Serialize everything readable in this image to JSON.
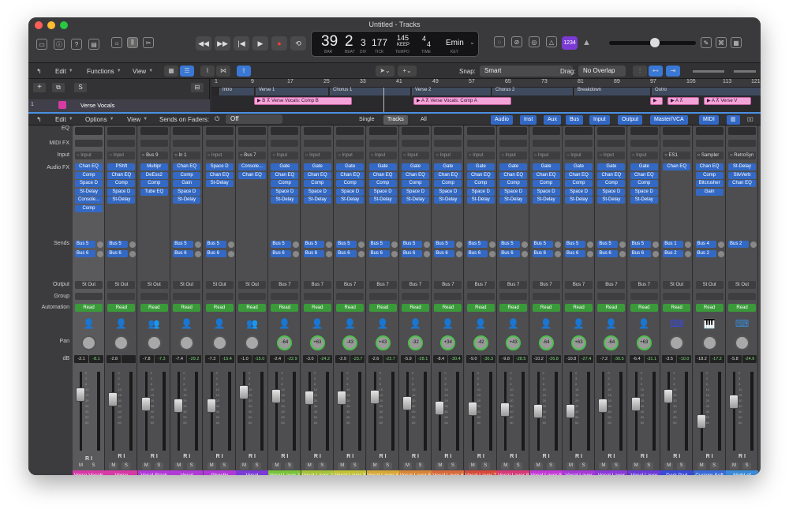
{
  "window": {
    "title": "Untitled - Tracks"
  },
  "lcd": {
    "bar": "39",
    "beat": "2",
    "div": "3",
    "tick": "177",
    "tempo": "145",
    "tempo_mode": "KEEP",
    "sig_top": "4",
    "sig_bottom": "4",
    "key": "Emin",
    "labels": {
      "bar": "BAR",
      "beat": "BEAT",
      "div": "DIV",
      "tick": "TICK",
      "tempo": "TEMPO",
      "time": "TIME",
      "key": "KEY"
    }
  },
  "count_in_badge": "1234",
  "tracks_toolbar": {
    "edit": "Edit",
    "functions": "Functions",
    "view": "View",
    "snap_label": "Snap:",
    "snap_value": "Smart",
    "drag_label": "Drag:",
    "drag_value": "No Overlap"
  },
  "arrange": {
    "track_number": "1",
    "track_name": "Verse Vocals",
    "ruler_ticks": [
      "1",
      "9",
      "17",
      "25",
      "33",
      "41",
      "49",
      "57",
      "65",
      "73",
      "81",
      "89",
      "97",
      "105",
      "113",
      "121"
    ],
    "markers": [
      "Intro",
      "Verse 1",
      "Chorus 1",
      "Verse 2",
      "Chorus 2",
      "Breakdown",
      "Outro"
    ],
    "regions": [
      "Verse Vocals: Comp B",
      "Verse Vocals: Comp A",
      "Verse V"
    ]
  },
  "mixer_toolbar": {
    "edit": "Edit",
    "options": "Options",
    "view": "View",
    "sends_on_faders_label": "Sends on Faders:",
    "sends_on_faders_value": "Off",
    "single": "Single",
    "tracks": "Tracks",
    "all": "All",
    "filters": [
      "Audio",
      "Inst",
      "Aux",
      "Bus",
      "Input",
      "Output",
      "Master/VCA",
      "MIDI"
    ]
  },
  "row_labels": {
    "eq": "EQ",
    "midi_fx": "MIDI FX",
    "input": "Input",
    "audio_fx": "Audio FX",
    "sends": "Sends",
    "output": "Output",
    "group": "Group",
    "automation": "Automation",
    "pan": "Pan",
    "db": "dB"
  },
  "fader_scale": [
    "0",
    "3",
    "6",
    "10",
    "15",
    "20",
    "30",
    "40",
    "50",
    "60"
  ],
  "channels": [
    {
      "name": "Verse Vocals",
      "color": "#d63aa5",
      "icon": "person",
      "input": "Input",
      "fx": [
        "Chan EQ",
        "Comp",
        "Space D",
        "St-Delay",
        "Console...",
        "Comp"
      ],
      "sends": [
        "Bus 5",
        "Bus 6"
      ],
      "output": "St Out",
      "auto": "Read",
      "pan": "",
      "db1": "-2.1",
      "db2": "-8.1",
      "fader": 0.74,
      "ri": "R I"
    },
    {
      "name": "Verse Harmony",
      "color": "#d63aa5",
      "icon": "person",
      "input": "Input",
      "fx": [
        "PShft",
        "Chan EQ",
        "Comp",
        "Space D",
        "St-Delay"
      ],
      "sends": [
        "Bus 5",
        "Bus 6"
      ],
      "output": "St Out",
      "auto": "Read",
      "pan": "",
      "db1": "-2.8",
      "db2": "",
      "fader": 0.68,
      "ri": "R I"
    },
    {
      "name": "Vocal Stack",
      "color": "#b03ad6",
      "icon": "group",
      "input": "Bus 9",
      "fx": [
        "Multipr",
        "DeEss2",
        "Comp",
        "Tube EQ"
      ],
      "sends": [],
      "output": "St Out",
      "auto": "Read",
      "pan": "",
      "db1": "-7.8",
      "db2": "-7.3",
      "fader": 0.6,
      "ri": "R I"
    },
    {
      "name": "Vocal Response",
      "color": "#b03ad6",
      "icon": "person",
      "input": "In 1",
      "fx": [
        "Chan EQ",
        "Comp",
        "Gain",
        "Space D",
        "St-Delay"
      ],
      "sends": [
        "Bus 5",
        "Bus 6"
      ],
      "output": "St Out",
      "auto": "Read",
      "pan": "",
      "db1": "-7.4",
      "db2": "-29.2",
      "fader": 0.58,
      "ri": "R I"
    },
    {
      "name": "Ghostly Vocals",
      "color": "#b03ad6",
      "icon": "person",
      "input": "Input",
      "fx": [
        "Space D",
        "Chan EQ",
        "St-Delay"
      ],
      "sends": [
        "Bus 5",
        "Bus 6"
      ],
      "output": "St Out",
      "auto": "Read",
      "pan": "",
      "db1": "-7.3",
      "db2": "-15.4",
      "fader": 0.58,
      "ri": "R I"
    },
    {
      "name": "Vocal Textures",
      "color": "#7b3ad6",
      "icon": "group",
      "input": "Bus 7",
      "fx": [
        "Console...",
        "Chan EQ"
      ],
      "sends": [],
      "output": "St Out",
      "auto": "Read",
      "pan": "",
      "db1": "-1.0",
      "db2": "-15.0",
      "fader": 0.78,
      "ri": "R I"
    },
    {
      "name": "Vocal Layer 1",
      "color": "#7ac23a",
      "icon": "person",
      "input": "Input",
      "fx": [
        "Gate",
        "Chan EQ",
        "Comp",
        "Space D",
        "St-Delay"
      ],
      "sends": [
        "Bus 5",
        "Bus 6"
      ],
      "output": "Bus 7",
      "auto": "Read",
      "pan": "-64",
      "db1": "-2.4",
      "db2": "-22.9",
      "fader": 0.72,
      "ri": "R I"
    },
    {
      "name": "Vocal Layer 2",
      "color": "#a6c23a",
      "icon": "person",
      "input": "Input",
      "fx": [
        "Gate",
        "Chan EQ",
        "Comp",
        "Space D",
        "St-Delay"
      ],
      "sends": [
        "Bus 5",
        "Bus 6"
      ],
      "output": "Bus 7",
      "auto": "Read",
      "pan": "+63",
      "db1": "-3.0",
      "db2": "-24.2",
      "fader": 0.7,
      "ri": "R I"
    },
    {
      "name": "Vocal Layer 3",
      "color": "#c2c23a",
      "icon": "person",
      "input": "Input",
      "fx": [
        "Gate",
        "Chan EQ",
        "Comp",
        "Space D",
        "St-Delay"
      ],
      "sends": [
        "Bus 5",
        "Bus 6"
      ],
      "output": "Bus 7",
      "auto": "Read",
      "pan": "-43",
      "db1": "-2.9",
      "db2": "-23.7",
      "fader": 0.7,
      "ri": "R I"
    },
    {
      "name": "Vocal Layer 4",
      "color": "#d6a83a",
      "icon": "person",
      "input": "Input",
      "fx": [
        "Gate",
        "Chan EQ",
        "Comp",
        "Space D",
        "St-Delay"
      ],
      "sends": [
        "Bus 5",
        "Bus 6"
      ],
      "output": "Bus 7",
      "auto": "Read",
      "pan": "+43",
      "db1": "-2.6",
      "db2": "-22.7",
      "fader": 0.71,
      "ri": "R I"
    },
    {
      "name": "Vocal Layer 5",
      "color": "#d6863a",
      "icon": "person",
      "input": "Input",
      "fx": [
        "Gate",
        "Chan EQ",
        "Comp",
        "Space D",
        "St-Delay"
      ],
      "sends": [
        "Bus 5",
        "Bus 6"
      ],
      "output": "Bus 7",
      "auto": "Read",
      "pan": "-32",
      "db1": "-5.9",
      "db2": "-28.1",
      "fader": 0.62,
      "ri": "R I"
    },
    {
      "name": "Vocal Layer 6",
      "color": "#d66a3a",
      "icon": "person",
      "input": "Input",
      "fx": [
        "Gate",
        "Chan EQ",
        "Comp",
        "Space D",
        "St-Delay"
      ],
      "sends": [
        "Bus 5",
        "Bus 6"
      ],
      "output": "Bus 7",
      "auto": "Read",
      "pan": "+34",
      "db1": "-8.4",
      "db2": "-30.4",
      "fader": 0.55,
      "ri": "R I"
    },
    {
      "name": "Vocal Layer 7",
      "color": "#d64a3a",
      "icon": "person",
      "input": "Input",
      "fx": [
        "Gate",
        "Chan EQ",
        "Comp",
        "Space D",
        "St-Delay"
      ],
      "sends": [
        "Bus 5",
        "Bus 6"
      ],
      "output": "Bus 7",
      "auto": "Read",
      "pan": "-42",
      "db1": "-9.0",
      "db2": "-30.3",
      "fader": 0.54,
      "ri": "R I"
    },
    {
      "name": "Vocal Layer 8",
      "color": "#d63a78",
      "icon": "person",
      "input": "Input",
      "fx": [
        "Gate",
        "Chan EQ",
        "Comp",
        "Space D",
        "St-Delay"
      ],
      "sends": [
        "Bus 5",
        "Bus 6"
      ],
      "output": "Bus 7",
      "auto": "Read",
      "pan": "+43",
      "db1": "-9.8",
      "db2": "-28.5",
      "fader": 0.52,
      "ri": "R I"
    },
    {
      "name": "Vocal Layer 9",
      "color": "#c23ad6",
      "icon": "person",
      "input": "Input",
      "fx": [
        "Gate",
        "Chan EQ",
        "Comp",
        "Space D",
        "St-Delay"
      ],
      "sends": [
        "Bus 5",
        "Bus 6"
      ],
      "output": "Bus 7",
      "auto": "Read",
      "pan": "-64",
      "db1": "-10.2",
      "db2": "-26.8",
      "fader": 0.5,
      "ri": "R I"
    },
    {
      "name": "Vocal Layer 10",
      "color": "#a63ad6",
      "icon": "person",
      "input": "Input",
      "fx": [
        "Gate",
        "Chan EQ",
        "Comp",
        "Space D",
        "St-Delay"
      ],
      "sends": [
        "Bus 5",
        "Bus 6"
      ],
      "output": "Bus 7",
      "auto": "Read",
      "pan": "+63",
      "db1": "-10.8",
      "db2": "-27.4",
      "fader": 0.5,
      "ri": "R I"
    },
    {
      "name": "Vocal Layer 11",
      "color": "#8a3ad6",
      "icon": "person",
      "input": "Input",
      "fx": [
        "Gate",
        "Chan EQ",
        "Comp",
        "Space D",
        "St-Delay"
      ],
      "sends": [
        "Bus 5",
        "Bus 6"
      ],
      "output": "Bus 7",
      "auto": "Read",
      "pan": "-64",
      "db1": "-7.2",
      "db2": "-30.5",
      "fader": 0.58,
      "ri": "R I"
    },
    {
      "name": "Vocal Layer 12",
      "color": "#6a3ad6",
      "icon": "person",
      "input": "Input",
      "fx": [
        "Gate",
        "Chan EQ",
        "Comp",
        "Space D",
        "St-Delay"
      ],
      "sends": [
        "Bus 5",
        "Bus 6"
      ],
      "output": "Bus 7",
      "auto": "Read",
      "pan": "+63",
      "db1": "-6.4",
      "db2": "-31.1",
      "fader": 0.6,
      "ri": "R I"
    },
    {
      "name": "Dark Pad",
      "color": "#3a4ad6",
      "icon": "synth",
      "input": "ES1",
      "fx": [
        "Chan EQ"
      ],
      "sends": [
        "Bus 1",
        "Bus 2"
      ],
      "output": "St Out",
      "auto": "Read",
      "pan": "",
      "db1": "-3.5",
      "db2": "-10.0",
      "fader": 0.72,
      "ri": "R I"
    },
    {
      "name": "Custom Soft Piano",
      "color": "#3a6ad6",
      "icon": "piano",
      "input": "Sampler",
      "fx": [
        "Chan EQ",
        "Comp",
        "Bitcrusher",
        "Gain"
      ],
      "sends": [
        "Bus 4",
        "Bus 2"
      ],
      "output": "St Out",
      "auto": "Read",
      "pan": "",
      "db1": "-18.2",
      "db2": "-17.2",
      "fader": 0.35,
      "ri": "R I"
    },
    {
      "name": "Night of Avalon",
      "color": "#3a8ad6",
      "icon": "synth",
      "input": "RetroSyn",
      "fx": [
        "St-Delay",
        "SilvVerb",
        "Chan EQ"
      ],
      "sends": [
        "Bus 2"
      ],
      "output": "St Out",
      "auto": "Read",
      "pan": "",
      "db1": "-5.8",
      "db2": "-24.6",
      "fader": 0.64,
      "ri": "R I"
    }
  ]
}
